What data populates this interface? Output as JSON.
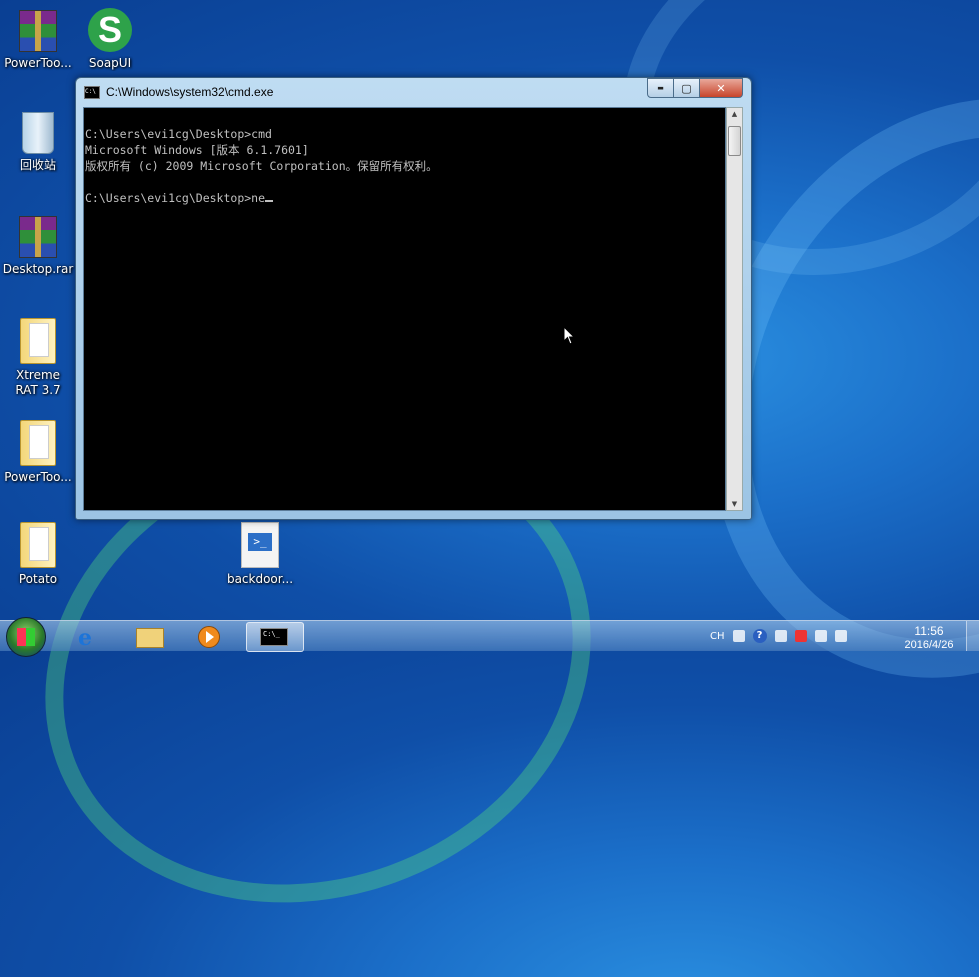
{
  "desktop": {
    "icons": [
      {
        "label": "PowerToo..."
      },
      {
        "label": "SoapUI"
      },
      {
        "label": "回收站"
      },
      {
        "label": "Desktop.rar"
      },
      {
        "label": "Xtreme RAT 3.7"
      },
      {
        "label": "PowerToo..."
      },
      {
        "label": "Potato"
      },
      {
        "label": "backdoor..."
      }
    ]
  },
  "window": {
    "title": "C:\\Windows\\system32\\cmd.exe",
    "min_glyph": "▬",
    "max_glyph": "▢",
    "close_glyph": "✕",
    "icon_text": "C:\\"
  },
  "console": {
    "lines": [
      "C:\\Users\\evi1cg\\Desktop>cmd",
      "Microsoft Windows [版本 6.1.7601]",
      "版权所有 (c) 2009 Microsoft Corporation。保留所有权利。",
      "",
      "C:\\Users\\evi1cg\\Desktop>ne"
    ]
  },
  "taskbar": {
    "ie_glyph": "e",
    "cmd_glyph": "C:\\_",
    "tray_lang": "CH",
    "help_glyph": "?",
    "time": "11:56",
    "date": "2016/4/26"
  }
}
